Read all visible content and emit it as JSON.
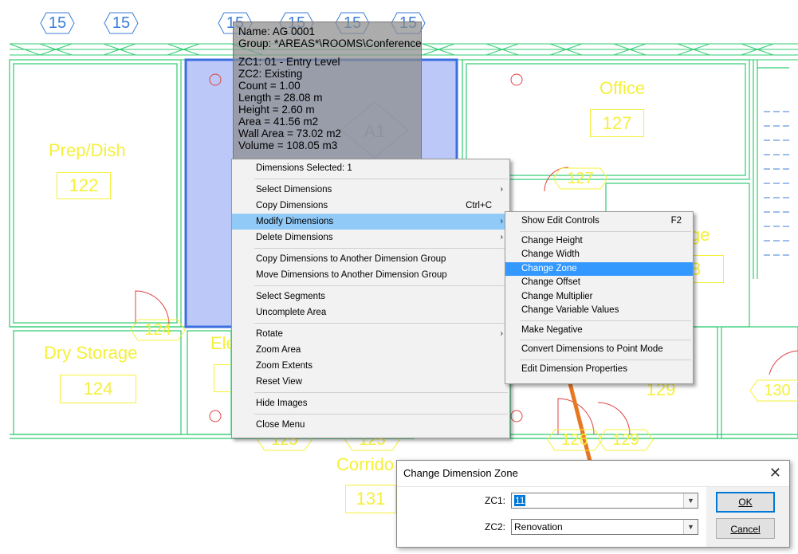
{
  "hex_markers": [
    "15",
    "15",
    "15",
    "15",
    "15",
    "15"
  ],
  "rooms": {
    "prep_dish": {
      "name": "Prep/Dish",
      "number": "122"
    },
    "office": {
      "name": "Office",
      "number": "127"
    },
    "dry_storage": {
      "name": "Dry Storage",
      "number": "124"
    },
    "electrical_fragment": {
      "name": "Ele"
    },
    "storage_fragment": {
      "name": "ge",
      "number": "8"
    },
    "corridor": {
      "name": "Corrido",
      "number": "131"
    },
    "room_129": {
      "number": "129"
    }
  },
  "door_tags": [
    "127",
    "124",
    "125",
    "125",
    "126",
    "129",
    "130"
  ],
  "area_marker": "A1",
  "tooltip": {
    "lines1": [
      "Name: AG 0001",
      "Group: *AREAS*\\ROOMS\\Conference"
    ],
    "lines2": [
      "ZC1: 01 - Entry Level",
      "ZC2: Existing",
      "Count = 1.00",
      "Length = 28.08 m",
      "Height = 2.60 m",
      "Area = 41.56 m2",
      "Wall Area = 73.02 m2",
      "Volume = 108.05 m3"
    ]
  },
  "context_menu": {
    "header": "Dimensions Selected: 1",
    "items": [
      {
        "label": "Select Dimensions",
        "submenu": true
      },
      {
        "label": "Copy Dimensions",
        "shortcut": "Ctrl+C"
      },
      {
        "label": "Modify Dimensions",
        "submenu": true,
        "highlighted": true
      },
      {
        "label": "Delete Dimensions",
        "submenu": true
      },
      {
        "label": "Copy Dimensions to Another Dimension Group"
      },
      {
        "label": "Move Dimensions to Another Dimension Group"
      },
      {
        "label": "Select Segments"
      },
      {
        "label": "Uncomplete Area"
      },
      {
        "label": "Rotate",
        "submenu": true
      },
      {
        "label": "Zoom Area"
      },
      {
        "label": "Zoom Extents"
      },
      {
        "label": "Reset View"
      },
      {
        "label": "Hide Images"
      },
      {
        "label": "Close Menu"
      }
    ],
    "submenu_arrow": "›"
  },
  "sub_menu": {
    "items": [
      {
        "label": "Show Edit Controls",
        "shortcut": "F2"
      },
      {
        "label": "Change Height"
      },
      {
        "label": "Change Width"
      },
      {
        "label": "Change Zone",
        "selected": true
      },
      {
        "label": "Change Offset"
      },
      {
        "label": "Change Multiplier"
      },
      {
        "label": "Change Variable Values"
      },
      {
        "label": "Make Negative"
      },
      {
        "label": "Convert Dimensions to Point Mode"
      },
      {
        "label": "Edit Dimension Properties"
      }
    ]
  },
  "dialog": {
    "title": "Change Dimension Zone",
    "close_glyph": "✕",
    "zc1_label": "ZC1:",
    "zc1_value": "11",
    "zc2_label": "ZC2:",
    "zc2_value": "Renovation",
    "dropdown_glyph": "▼",
    "ok_label": "OK",
    "cancel_label": "Cancel"
  },
  "colors": {
    "wall": "#2ecc71",
    "room_text": "#f5f03a",
    "selection": "#3b6fe0",
    "arrow": "#e87722",
    "menu_highlight": "#91c9f7",
    "menu_selected": "#3399ff"
  }
}
